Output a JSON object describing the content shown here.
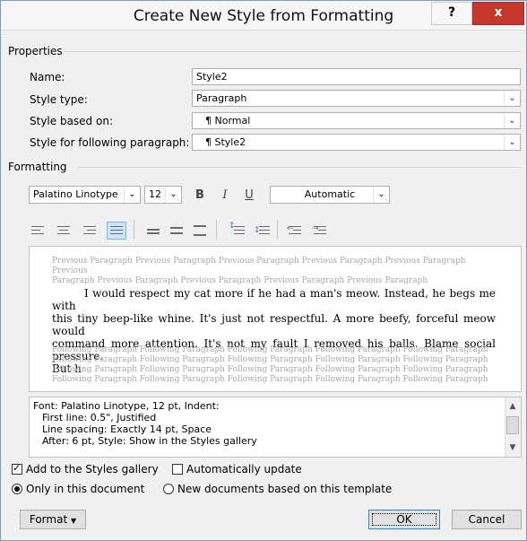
{
  "window": {
    "title": "Create New Style from Formatting",
    "help_label": "?",
    "close_label": "x"
  },
  "properties": {
    "group_label": "Properties",
    "name": {
      "label": "Name:",
      "value": "Style2"
    },
    "style_type": {
      "label": "Style type:",
      "value": "Paragraph"
    },
    "based_on": {
      "label": "Style based on:",
      "value": "Normal",
      "icon": "pilcrow-icon"
    },
    "following": {
      "label": "Style for following paragraph:",
      "value": "Style2",
      "icon": "pilcrow-icon"
    }
  },
  "formatting": {
    "group_label": "Formatting",
    "font": "Palatino Linotype",
    "size": "12",
    "bold": "B",
    "italic": "I",
    "underline": "U",
    "color": "Automatic",
    "alignment_selected": "justify"
  },
  "preview": {
    "previous_lines": [
      "Previous Paragraph Previous Paragraph Previous Paragraph Previous Paragraph Previous Paragraph Previous",
      "Paragraph Previous Paragraph Previous Paragraph Previous Paragraph Previous Paragraph"
    ],
    "sample_lines": [
      "I would respect my cat more if he had a man's meow. Instead, he begs me with",
      "this tiny beep-like whine. It's just not respectful. A more beefy, forceful meow would",
      "command more attention. It's not my fault I removed his balls. Blame social pressure.",
      "But h"
    ],
    "following_lines": [
      "Following Paragraph Following Paragraph Following Paragraph Following Paragraph Following Paragraph",
      "Following Paragraph Following Paragraph Following Paragraph Following Paragraph Following Paragraph",
      "Following Paragraph Following Paragraph Following Paragraph Following Paragraph Following Paragraph",
      "Following Paragraph Following Paragraph Following Paragraph Following Paragraph Following Paragraph"
    ]
  },
  "description": [
    "Font: Palatino Linotype, 12 pt, Indent:",
    "First line:  0.5\", Justified",
    "Line spacing:  Exactly 14 pt, Space",
    "After:  6 pt, Style: Show in the Styles gallery"
  ],
  "options": {
    "add_to_gallery": {
      "label": "Add to the Styles gallery",
      "checked": true
    },
    "auto_update": {
      "label": "Automatically update",
      "checked": false
    },
    "only_this_doc": {
      "label": "Only in this document",
      "selected": true
    },
    "new_docs": {
      "label": "New documents based on this template",
      "selected": false
    }
  },
  "buttons": {
    "format": "Format",
    "ok": "OK",
    "cancel": "Cancel"
  }
}
